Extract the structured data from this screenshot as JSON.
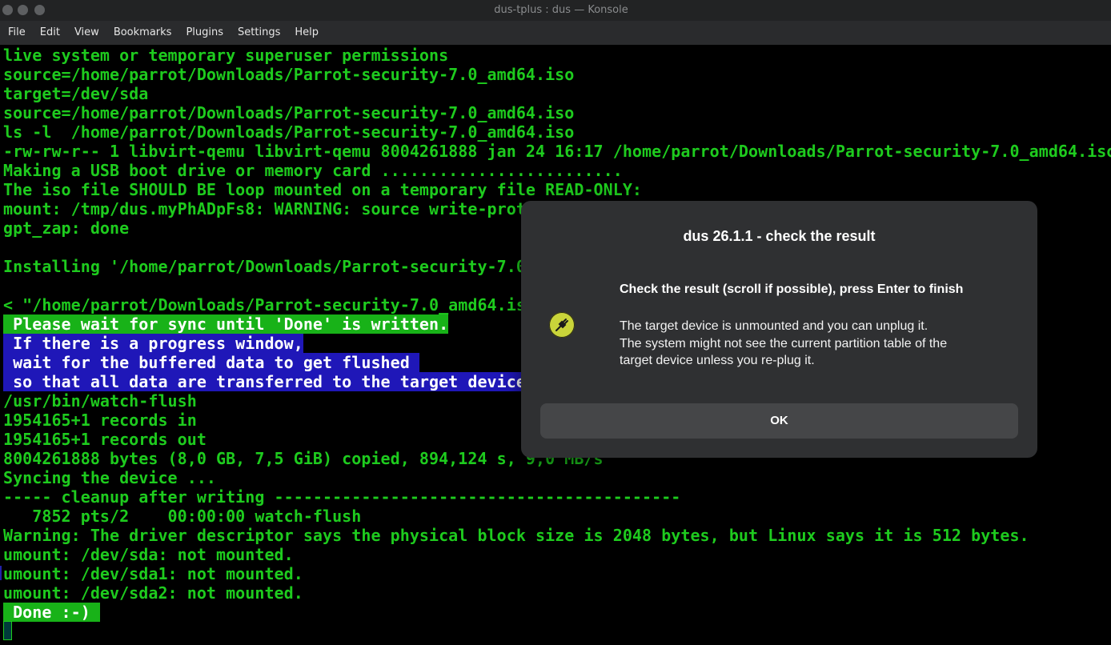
{
  "window": {
    "title": "dus-tplus : dus — Konsole"
  },
  "menubar": {
    "items": [
      "File",
      "Edit",
      "View",
      "Bookmarks",
      "Plugins",
      "Settings",
      "Help"
    ]
  },
  "terminal": {
    "lines": [
      {
        "text": "live system or temporary superuser permissions",
        "style": "plain"
      },
      {
        "text": "source=/home/parrot/Downloads/Parrot-security-7.0_amd64.iso",
        "style": "plain"
      },
      {
        "text": "target=/dev/sda",
        "style": "plain"
      },
      {
        "text": "source=/home/parrot/Downloads/Parrot-security-7.0_amd64.iso",
        "style": "plain"
      },
      {
        "text": "ls -l  /home/parrot/Downloads/Parrot-security-7.0_amd64.iso",
        "style": "plain"
      },
      {
        "text": "-rw-rw-r-- 1 libvirt-qemu libvirt-qemu 8004261888 jan 24 16:17 /home/parrot/Downloads/Parrot-security-7.0_amd64.iso",
        "style": "plain"
      },
      {
        "text": "Making a USB boot drive or memory card .........................",
        "style": "plain"
      },
      {
        "text": "The iso file SHOULD BE loop mounted on a temporary file READ-ONLY:",
        "style": "plain"
      },
      {
        "text": "mount: /tmp/dus.myPhADpFs8: WARNING: source write-prot",
        "style": "plain"
      },
      {
        "text": "gpt_zap: done",
        "style": "plain"
      },
      {
        "text": "",
        "style": "plain"
      },
      {
        "text": "Installing '/home/parrot/Downloads/Parrot-security-7.0",
        "style": "plain"
      },
      {
        "text": "",
        "style": "plain"
      },
      {
        "text": "< \"/home/parrot/Downloads/Parrot-security-7.0_amd64.is",
        "style": "plain"
      },
      {
        "text": " Please wait for sync until 'Done' is written.",
        "style": "green"
      },
      {
        "text": " If there is a progress window,",
        "style": "blue"
      },
      {
        "text": " wait for the buffered data to get flushed ",
        "style": "blue"
      },
      {
        "text": " so that all data are transferred to the target device",
        "style": "blue"
      },
      {
        "text": "/usr/bin/watch-flush",
        "style": "plain"
      },
      {
        "text": "1954165+1 records in",
        "style": "plain"
      },
      {
        "text": "1954165+1 records out",
        "style": "plain"
      },
      {
        "text": "8004261888 bytes (8,0 GB, 7,5 GiB) copied, 894,124 s, 9,0 MB/s",
        "style": "plain"
      },
      {
        "text": "Syncing the device ...",
        "style": "plain"
      },
      {
        "text": "----- cleanup after writing ------------------------------------------",
        "style": "plain"
      },
      {
        "text": "   7852 pts/2    00:00:00 watch-flush",
        "style": "plain"
      },
      {
        "text": "Warning: The driver descriptor says the physical block size is 2048 bytes, but Linux says it is 512 bytes.",
        "style": "plain"
      },
      {
        "text": "umount: /dev/sda: not mounted.",
        "style": "plain"
      },
      {
        "text": "umount: /dev/sda1: not mounted.",
        "style": "plain"
      },
      {
        "text": "umount: /dev/sda2: not mounted.",
        "style": "plain"
      },
      {
        "text": " Done :-) ",
        "style": "green"
      }
    ]
  },
  "dialog": {
    "title": "dus 26.1.1 - check the result",
    "icon": "usb-plug-icon",
    "heading": "Check the result (scroll if possible), press Enter to finish",
    "body_lines": [
      "The target device is unmounted and you can unplug it.",
      "The system might not see the current partition table of the",
      "target device unless you re-plug it."
    ],
    "ok_label": "OK"
  },
  "colors": {
    "terminal_text": "#1ecb1e",
    "highlight_green": "#18b218",
    "highlight_blue": "#1f17b8",
    "dialog_bg": "#2f3032",
    "icon_yellow": "#c9d43a"
  }
}
